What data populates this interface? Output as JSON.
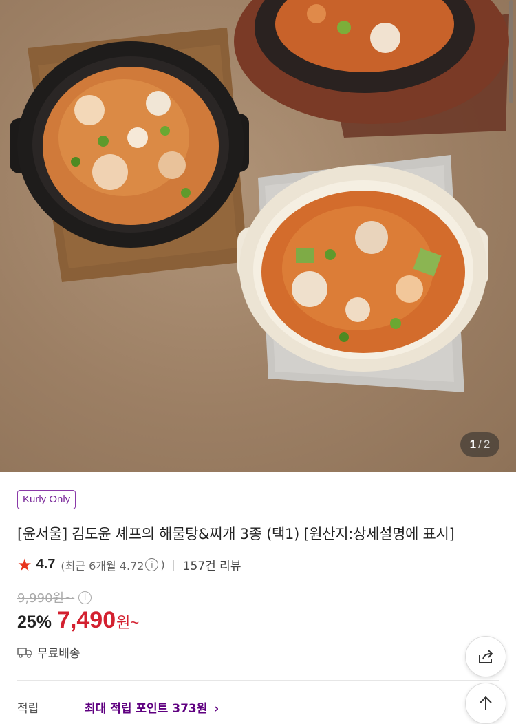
{
  "hero": {
    "image_alt": "",
    "counter_current": "1",
    "counter_separator": "/",
    "counter_total": "2"
  },
  "product": {
    "badge": "Kurly Only",
    "title": "[윤서울] 김도윤 셰프의 해물탕&찌개 3종 (택1) [원산지:상세설명에 표시]",
    "rating": "4.7",
    "recent_rating_text": "(최근 6개월 4.72",
    "recent_rating_close": ")",
    "review_link": "157건 리뷰",
    "original_price": "9,990원~",
    "discount_rate": "25%",
    "sale_price": "7,490",
    "sale_price_unit": "원~",
    "shipping": "무료배송",
    "points_label": "적립",
    "points_value": "최대 적립 포인트 373원"
  },
  "colors": {
    "accent_red": "#d3202f",
    "kurly_purple": "#5f0080",
    "star": "#e8341d"
  },
  "icons": [
    "star-icon",
    "info-icon",
    "truck-icon",
    "share-icon",
    "arrow-up-icon",
    "chevron-right-icon"
  ]
}
